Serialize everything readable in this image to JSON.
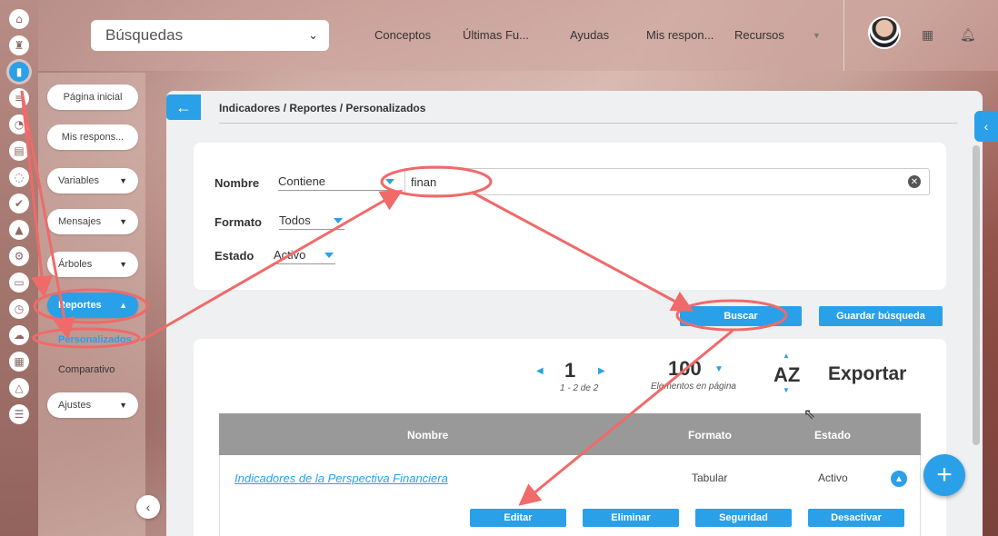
{
  "colors": {
    "accent": "#2aa0e8",
    "annotation": "#f06a6a"
  },
  "rail": {
    "icons": [
      "home-icon",
      "chess-rook-icon",
      "bar-chart-icon",
      "strikethrough-icon",
      "pie-icon",
      "doc-icon",
      "cycle-icon",
      "check-icon",
      "warning-icon",
      "gears-icon",
      "screen-icon",
      "clock-icon",
      "cloud-icon",
      "calendar-icon",
      "network-icon",
      "list-icon"
    ],
    "glyphs": [
      "⌂",
      "♜",
      "▮",
      "≡",
      "◔",
      "▤",
      "◌",
      "✔",
      "▲",
      "⚙",
      "▭",
      "◷",
      "☁",
      "▦",
      "△",
      "☰"
    ]
  },
  "menu": {
    "pagina_inicial": "Página inicial",
    "mis_respons": "Mis respons...",
    "variables": "Variables",
    "mensajes": "Mensajes",
    "arboles": "Árboles",
    "reportes": "Reportes",
    "personalizados": "Personalizados",
    "comparativo": "Comparativo",
    "ajustes": "Ajustes"
  },
  "topbar": {
    "search_label": "Búsquedas",
    "links": [
      "Conceptos",
      "Últimas Fu...",
      "Ayudas",
      "Mis respon...",
      "Recursos"
    ]
  },
  "main": {
    "breadcrumb": "Indicadores / Reportes / Personalizados",
    "filters": {
      "nombre_label": "Nombre",
      "nombre_op": "Contiene",
      "nombre_value": "finan",
      "formato_label": "Formato",
      "formato_value": "Todos",
      "estado_label": "Estado",
      "estado_value": "Activo"
    },
    "buscar": "Buscar",
    "guardar": "Guardar búsqueda",
    "pager": {
      "page": "1",
      "range": "1 - 2 de 2",
      "per_page": "100",
      "per_page_label": "Elementos en página",
      "sort": "AZ",
      "export": "Exportar"
    },
    "table": {
      "headers": [
        "Nombre",
        "Formato",
        "Estado"
      ],
      "rows": [
        {
          "nombre": "Indicadores de la Perspectiva Financiera",
          "formato": "Tabular",
          "estado": "Activo"
        }
      ],
      "actions": [
        "Editar",
        "Eliminar",
        "Seguridad",
        "Desactivar"
      ]
    }
  }
}
